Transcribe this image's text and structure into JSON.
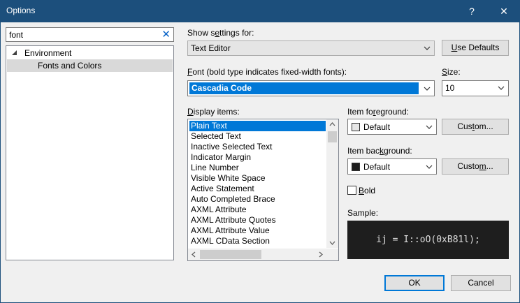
{
  "window": {
    "title": "Options",
    "help_glyph": "?",
    "close_glyph": "✕"
  },
  "search": {
    "value": "font",
    "clear_glyph": "✕"
  },
  "tree": {
    "items": [
      {
        "label": "Environment",
        "expanded": true
      },
      {
        "label": "Fonts and Colors",
        "selected": true
      }
    ]
  },
  "show_settings": {
    "label_pre": "Show s",
    "label_u": "e",
    "label_post": "ttings for:",
    "value": "Text Editor"
  },
  "use_defaults": {
    "label_u": "U",
    "label_post": "se Defaults"
  },
  "font": {
    "label_u": "F",
    "label_post": "ont (bold type indicates fixed-width fonts):",
    "value": "Cascadia Code"
  },
  "size": {
    "label_u": "S",
    "label_post": "ize:",
    "value": "10"
  },
  "display_items": {
    "label_u": "D",
    "label_post": "isplay items:",
    "items": [
      "Plain Text",
      "Selected Text",
      "Inactive Selected Text",
      "Indicator Margin",
      "Line Number",
      "Visible White Space",
      "Active Statement",
      "Auto Completed Brace",
      "AXML Attribute",
      "AXML Attribute Quotes",
      "AXML Attribute Value",
      "AXML CData Section"
    ],
    "selected_index": 0
  },
  "item_foreground": {
    "label_pre": "Item fo",
    "label_u": "r",
    "label_post": "eground:",
    "value": "Default",
    "swatch_color": "#e6e6e6",
    "custom_pre": "Cus",
    "custom_u": "t",
    "custom_post": "om..."
  },
  "item_background": {
    "label_pre": "Item bac",
    "label_u": "k",
    "label_post": "ground:",
    "value": "Default",
    "swatch_color": "#1e1e1e",
    "custom_pre": "Custo",
    "custom_u": "m",
    "custom_post": "..."
  },
  "bold": {
    "label_u": "B",
    "label_post": "old",
    "checked": false
  },
  "sample": {
    "label": "Sample:",
    "text": "ij = I::oO(0xB81l);"
  },
  "buttons": {
    "ok": "OK",
    "cancel": "Cancel"
  },
  "colors": {
    "titlebar": "#1c4f7c",
    "accent": "#0078d7",
    "sample_bg": "#1e1e1e"
  }
}
